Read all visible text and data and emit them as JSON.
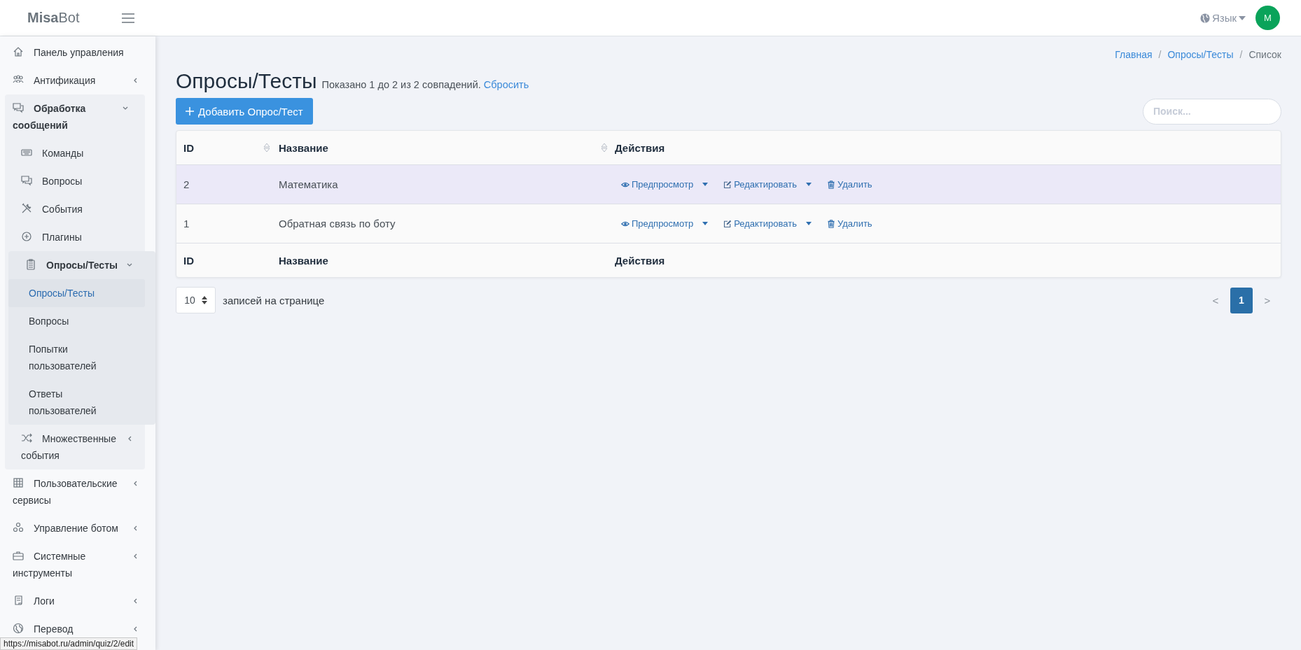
{
  "header": {
    "logo": "**Misa**Bot",
    "language": "Язык",
    "avatar_initial": "M"
  },
  "sidebar": {
    "items": [
      {
        "label": "Панель управления",
        "kind": "home",
        "selected": false
      },
      {
        "label": "Антификация",
        "kind": "people",
        "selected": false,
        "expanded": false
      },
      {
        "label": "Обработка сообщений",
        "kind": "chat",
        "selected": false,
        "expanded": true,
        "children": [
          {
            "label": "Команды",
            "kind": "keyboard",
            "selected": false
          },
          {
            "label": "Вопросы",
            "kind": "chat",
            "selected": false
          },
          {
            "label": "События",
            "kind": "tools",
            "selected": false
          },
          {
            "label": "Плагины",
            "kind": "plus",
            "selected": false
          },
          {
            "label": "Опросы/Тесты",
            "kind": "clipboard",
            "selected": false,
            "expanded": true,
            "children": [
              {
                "label": "Опросы/Тесты",
                "selected": true
              },
              {
                "label": "Вопросы",
                "selected": false
              },
              {
                "label": "Попытки пользователей",
                "selected": false
              },
              {
                "label": "Ответы пользователей",
                "selected": false
              }
            ]
          },
          {
            "label": "Множественные события",
            "kind": "shuffle",
            "selected": false,
            "expanded": false
          }
        ]
      },
      {
        "label": "Пользовательские сервисы",
        "kind": "grid",
        "selected": false,
        "expanded": false
      },
      {
        "label": "Управление ботом",
        "kind": "nodes",
        "selected": false,
        "expanded": false
      },
      {
        "label": "Системные инструменты",
        "kind": "briefcase",
        "selected": false,
        "expanded": false
      },
      {
        "label": "Логи",
        "kind": "scroll",
        "selected": false,
        "expanded": false
      },
      {
        "label": "Перевод",
        "kind": "globe",
        "selected": false,
        "expanded": false
      }
    ]
  },
  "breadcrumbs": {
    "separator": "/",
    "items": [
      {
        "label": "Главная",
        "current": false
      },
      {
        "label": "Опросы/Тесты",
        "current": false
      },
      {
        "label": "Список",
        "current": true
      }
    ]
  },
  "page": {
    "title": "Опросы/Тесты",
    "summary": "Показано 1 до 2 из 2 совпадений.",
    "reset_link": "Сбросить"
  },
  "add_button": "Добавить Опрос/Тест",
  "search": {
    "placeholder": "Поиск..."
  },
  "table": {
    "columns": [
      {
        "label": "ID",
        "sortable": true
      },
      {
        "label": "Название",
        "sortable": true
      },
      {
        "label": "Действия",
        "sortable": false
      }
    ],
    "rows": [
      {
        "id": "2",
        "name": "Математика",
        "hovered": true,
        "actions": [
          {
            "kind": "preview",
            "label": "Предпросмотр"
          },
          {
            "kind": "edit",
            "label": "Редактировать"
          },
          {
            "kind": "delete",
            "label": "Удалить"
          }
        ]
      },
      {
        "id": "1",
        "name": "Обратная связь по боту",
        "hovered": false,
        "actions": [
          {
            "kind": "preview",
            "label": "Предпросмотр"
          },
          {
            "kind": "edit",
            "label": "Редактировать"
          },
          {
            "kind": "delete",
            "label": "Удалить"
          }
        ]
      }
    ],
    "footer": [
      "ID",
      "Название",
      "Действия"
    ]
  },
  "per_page": {
    "value": "10",
    "label": "записей на странице"
  },
  "pagination": [
    {
      "kind": "prev",
      "label": "<",
      "disabled": true,
      "selected": false
    },
    {
      "kind": "page",
      "label": "1",
      "disabled": false,
      "selected": true
    },
    {
      "kind": "next",
      "label": ">",
      "disabled": true,
      "selected": false
    }
  ],
  "status_bar": {
    "url": "https://misabot.ru/admin/quiz/2/edit"
  }
}
